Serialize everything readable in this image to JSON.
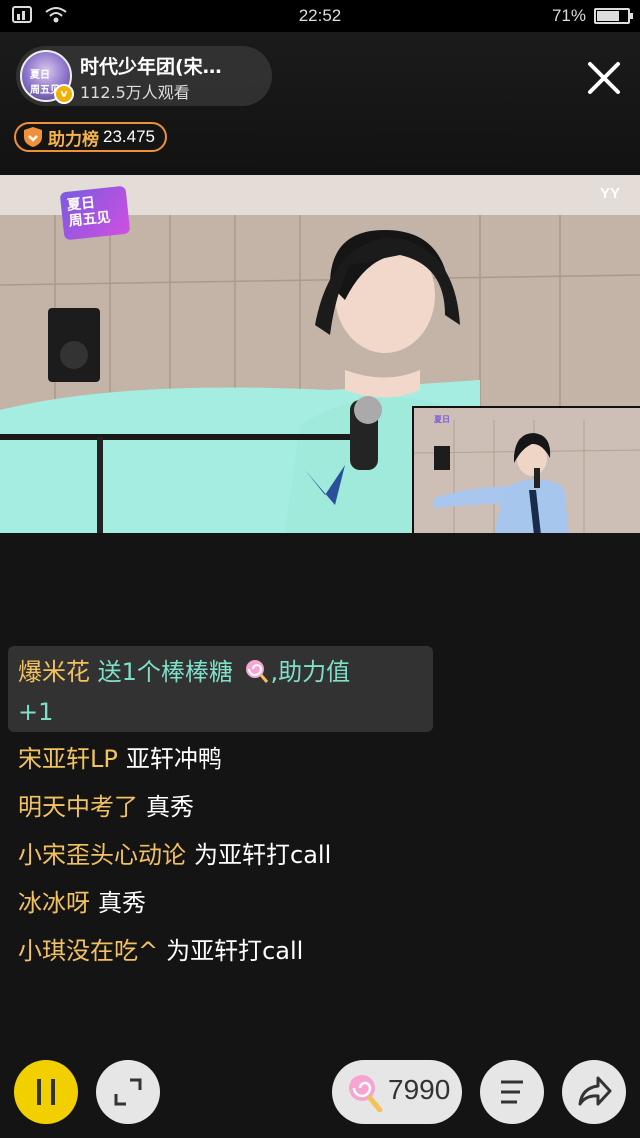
{
  "status_bar": {
    "time": "22:52",
    "battery": "71%",
    "icons": [
      "signal-icon",
      "wifi-icon",
      "battery-icon"
    ]
  },
  "header": {
    "anchor_name": "时代少年团(宋…",
    "viewers": "112.5万人观看",
    "avatar_text": "夏日\n周五见",
    "rank_label": "助力榜",
    "rank_value": "23.475"
  },
  "video": {
    "logo_text": "夏日周五见",
    "watermark": "YY"
  },
  "chat": {
    "gift_message": {
      "user": "爆米花",
      "text_before": " 送1个棒棒糖 ",
      "text_after": ",助力值",
      "text_line2": "+1"
    },
    "messages": [
      {
        "user": "宋亚轩LP",
        "text": "亚轩冲鸭"
      },
      {
        "user": "明天中考了",
        "text": "真秀"
      },
      {
        "user": "小宋歪头心动论",
        "text": "为亚轩打call"
      },
      {
        "user": "冰冰呀",
        "text": "真秀"
      },
      {
        "user": "小琪没在吃^",
        "text": "为亚轩打call"
      }
    ]
  },
  "bottom_bar": {
    "gift_count": "7990"
  },
  "colors": {
    "accent_yellow": "#f2d000",
    "username": "#f2c160",
    "gift_text": "#7fe0c9",
    "rank_border": "#f0903a"
  }
}
